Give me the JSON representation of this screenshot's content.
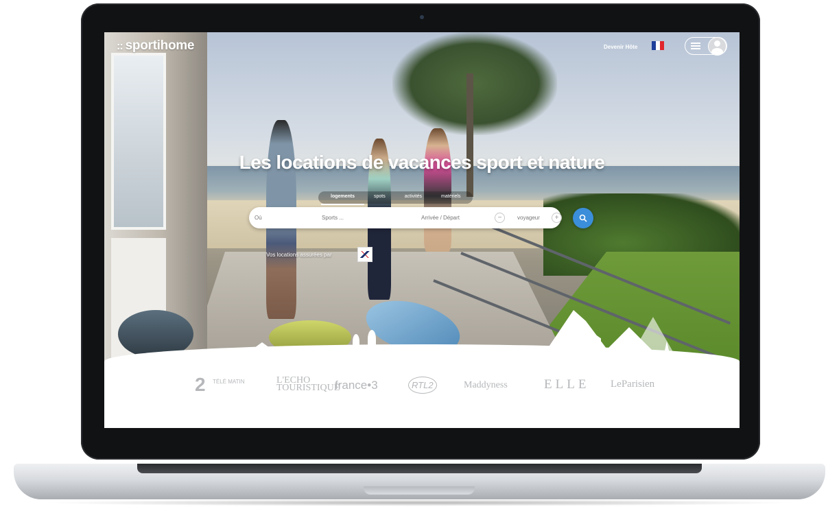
{
  "header": {
    "logo_icon": "::",
    "logo_text": "sportihome",
    "host_link": "Devenir Hôte",
    "language_flag": "french-flag-icon"
  },
  "hero": {
    "headline": "Les locations de vacances sport et nature",
    "tabs": [
      {
        "label": "logements",
        "active": true
      },
      {
        "label": "spots",
        "active": false
      },
      {
        "label": "activités",
        "active": false
      },
      {
        "label": "matériels",
        "active": false
      }
    ],
    "search": {
      "where_placeholder": "Où",
      "sports_placeholder": "Sports ...",
      "dates_placeholder": "Arrivée / Départ",
      "minus_label": "−",
      "travelers_label": "voyageur",
      "plus_label": "+"
    },
    "insured_text": "Vos locations assurées par"
  },
  "press": {
    "logos": [
      "TÉLÉ MATIN",
      "L'ECHO TOURISTIQUE",
      "france•3",
      "RTL2",
      "Maddyness",
      "ELLE",
      "LeParisien"
    ]
  },
  "colors": {
    "accent": "#3b8ed9",
    "press_logo": "#b5b7ba",
    "flag_blue": "#1f3f9a",
    "flag_white": "#ffffff",
    "flag_red": "#e0262c"
  }
}
